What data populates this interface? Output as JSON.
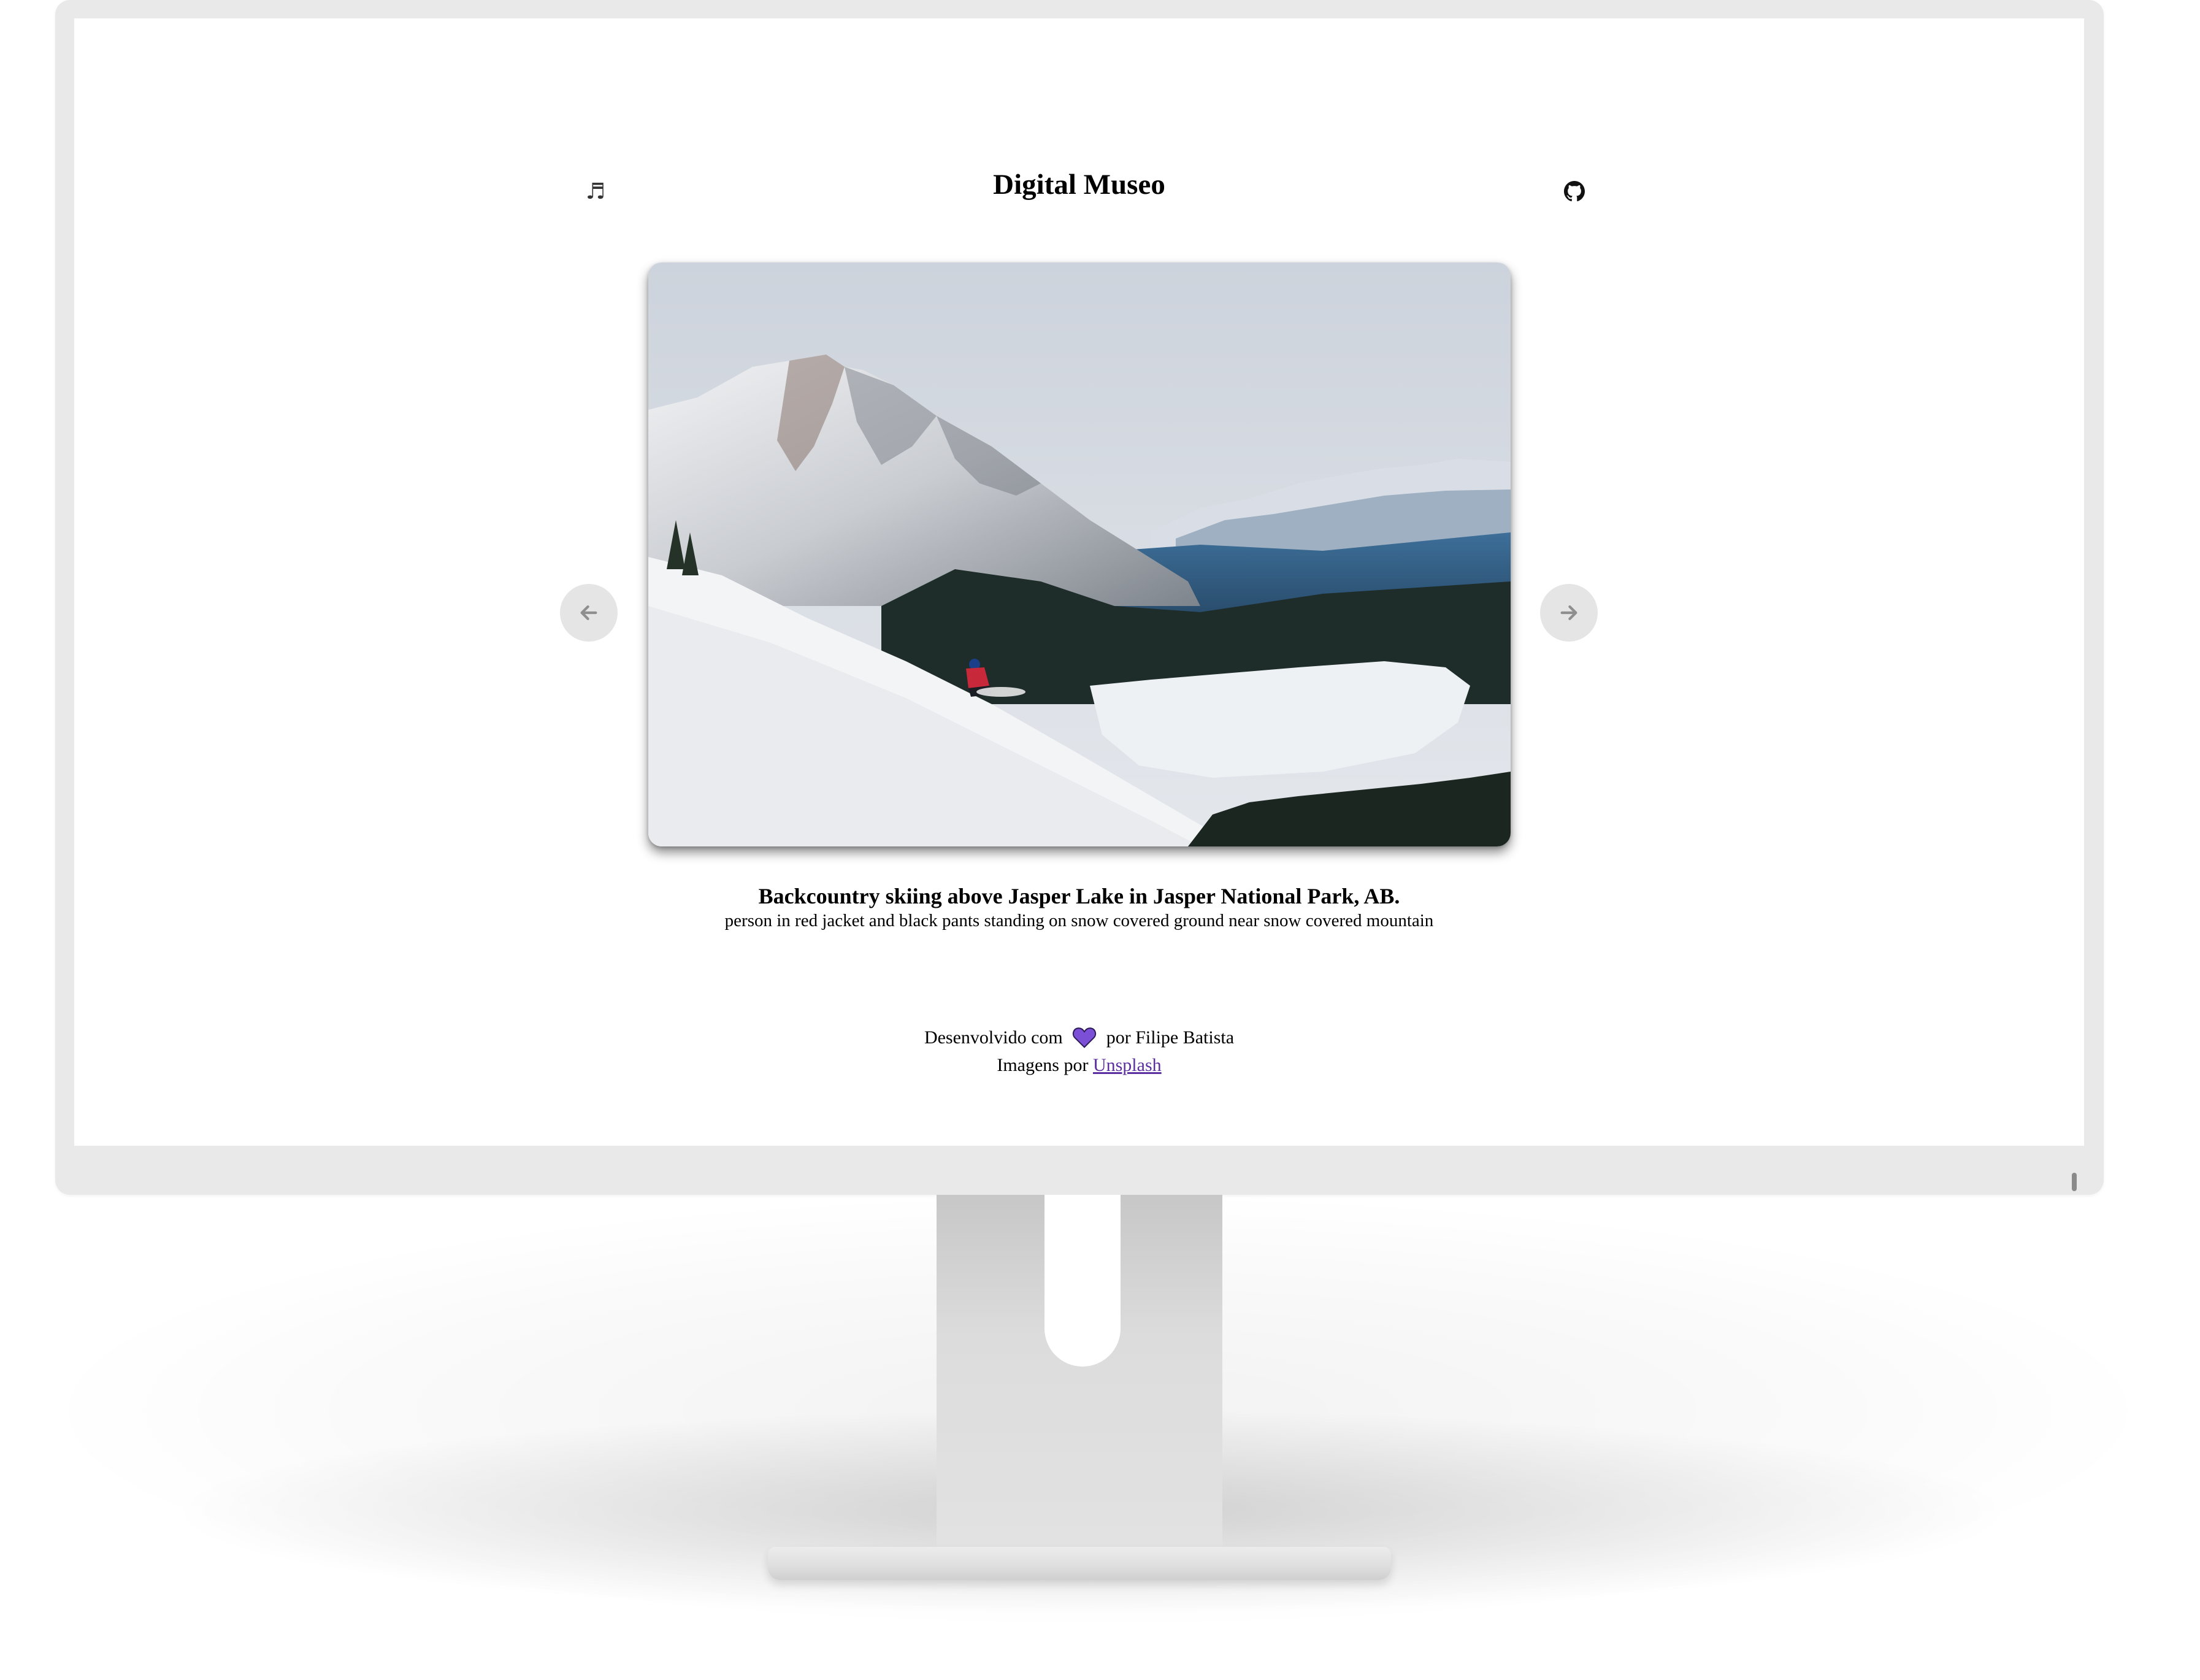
{
  "header": {
    "title": "Digital Museo",
    "music_icon": "music-note-icon",
    "github_icon": "github-icon"
  },
  "gallery": {
    "prev_icon": "arrow-left-icon",
    "next_icon": "arrow-right-icon",
    "image_description": "person in red jacket and black pants standing on snow covered ground near snow covered mountain",
    "caption_title": "Backcountry skiing above Jasper Lake in Jasper National Park, AB.",
    "caption_description": "person in red jacket and black pants standing on snow covered ground near snow covered mountain"
  },
  "footer": {
    "developed_prefix": "Desenvolvido com",
    "developed_suffix": "por Filipe Batista",
    "heart_color": "#7b4fd6",
    "images_prefix": "Imagens por",
    "images_link": "Unsplash"
  },
  "colors": {
    "bezel": "#e9e9e9",
    "nav_button_bg": "#e5e5e5",
    "link": "#5b2fa0"
  }
}
